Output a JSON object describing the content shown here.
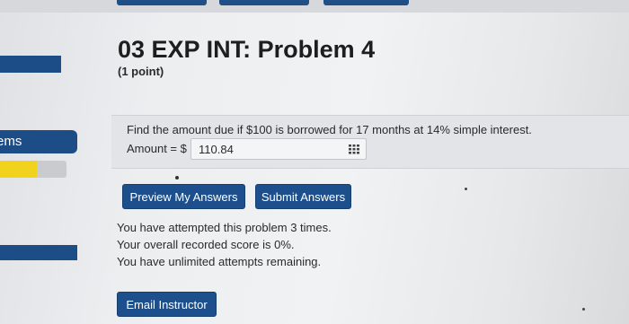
{
  "sidebar": {
    "section_label": "ems",
    "progress_fraction": 0.55
  },
  "problem": {
    "title": "03 EXP INT: Problem 4",
    "points": "(1 point)",
    "question": "Find the amount due if $100 is borrowed for 17 months at 14% simple interest.",
    "answer_label": "Amount = $",
    "answer_value": "110.84",
    "keypad_icon": "grid-keypad-icon"
  },
  "buttons": {
    "preview": "Preview My Answers",
    "submit": "Submit Answers",
    "email": "Email Instructor"
  },
  "status": {
    "attempts": "You have attempted this problem 3 times.",
    "score": "Your overall recorded score is 0%.",
    "remaining": "You have unlimited attempts remaining."
  },
  "colors": {
    "accent": "#1c4f8c",
    "progress": "#f1d21c"
  }
}
